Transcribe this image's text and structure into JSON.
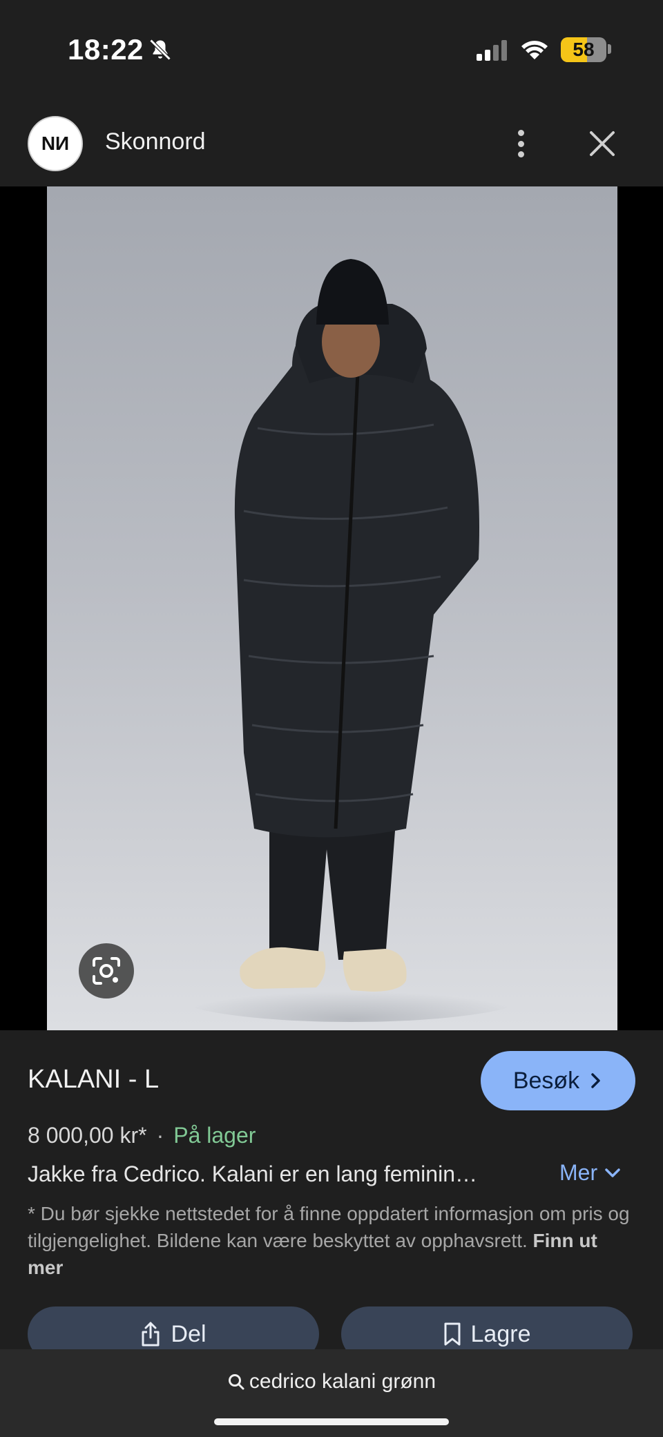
{
  "status_bar": {
    "time": "18:22",
    "battery_percent": "58",
    "battery_level": 0.58,
    "icons": [
      "bell-slash-icon",
      "cellular-signal-icon",
      "wifi-icon",
      "battery-icon"
    ]
  },
  "header": {
    "site_logo_text": "NИ",
    "site_name": "Skonnord",
    "icons": [
      "more-vert-icon",
      "close-icon"
    ]
  },
  "image": {
    "lens_icon": "google-lens-icon"
  },
  "product": {
    "title": "KALANI - L",
    "visit_label": "Besøk",
    "price": "8 000,00 kr*",
    "separator": "·",
    "stock": "På lager",
    "description": "Jakke fra Cedrico. Kalani er en lang feminin…",
    "more_label": "Mer",
    "disclaimer": "* Du bør sjekke nettstedet for å finne oppdatert informasjon om pris og tilgjengelighet. Bildene kan være beskyttet av opphavsrett.",
    "learn_more": "Finn ut mer",
    "share_label": "Del",
    "save_label": "Lagre"
  },
  "search": {
    "query": "cedrico kalani grønn"
  },
  "colors": {
    "accent": "#8ab4f8",
    "in_stock": "#81c995",
    "background": "#1f1f1f",
    "battery": "#f5c518"
  }
}
